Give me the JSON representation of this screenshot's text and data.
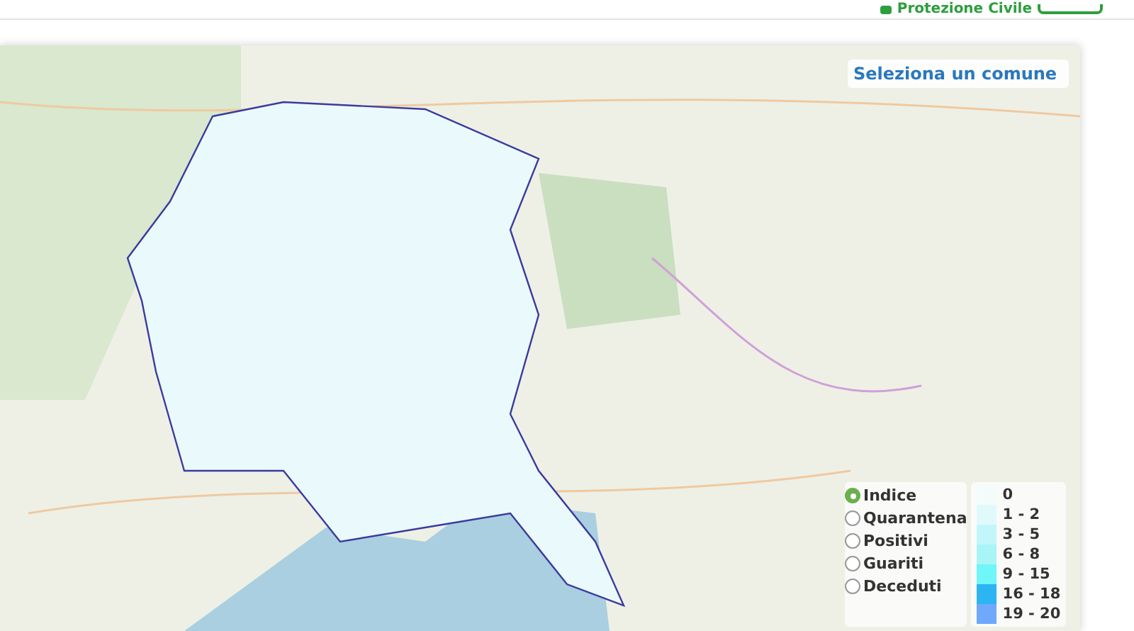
{
  "header": {
    "logo_text": "Protezione Civile"
  },
  "map": {
    "search_title": "Seleziona un comune",
    "layers": [
      {
        "label": "Indice",
        "selected": true
      },
      {
        "label": "Quarantena",
        "selected": false
      },
      {
        "label": "Positivi",
        "selected": false
      },
      {
        "label": "Guariti",
        "selected": false
      },
      {
        "label": "Deceduti",
        "selected": false
      }
    ],
    "legend": [
      {
        "label": "0",
        "color": "#f4fbfb"
      },
      {
        "label": "1 - 2",
        "color": "#e0fafc"
      },
      {
        "label": "3 - 5",
        "color": "#c2f6fa"
      },
      {
        "label": "6 - 8",
        "color": "#a8f5f8"
      },
      {
        "label": "9 - 15",
        "color": "#6ff6f8"
      },
      {
        "label": "16 - 18",
        "color": "#2cb5f2"
      },
      {
        "label": "19 - 20",
        "color": "#6ea9fb"
      }
    ]
  }
}
